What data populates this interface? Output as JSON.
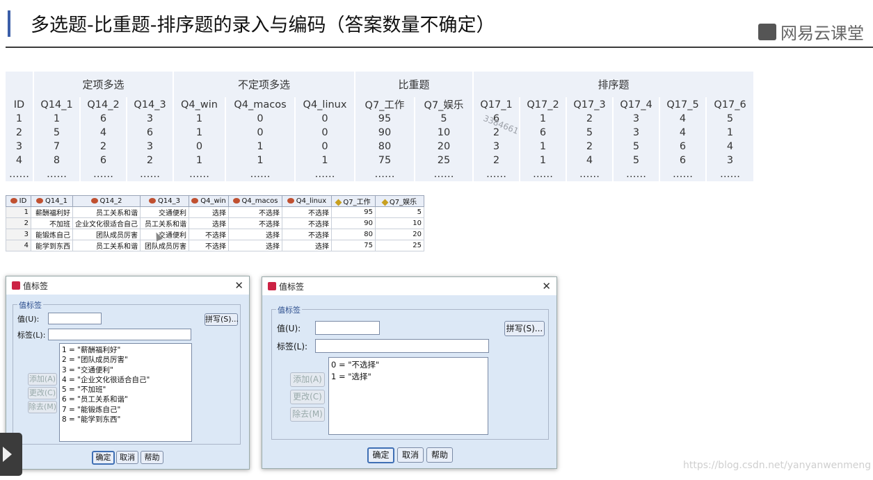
{
  "header": {
    "title": "多选题-比重题-排序题的录入与编码（答案数量不确定）",
    "logo": "网易云课堂"
  },
  "table": {
    "groups": [
      "定项多选",
      "不定项多选",
      "比重题",
      "排序题"
    ],
    "columns": [
      "ID",
      "Q14_1",
      "Q14_2",
      "Q14_3",
      "Q4_win",
      "Q4_macos",
      "Q4_linux",
      "Q7_工作",
      "Q7_娱乐",
      "Q17_1",
      "Q17_2",
      "Q17_3",
      "Q17_4",
      "Q17_5",
      "Q17_6"
    ],
    "rows": [
      [
        "1",
        "1",
        "6",
        "3",
        "1",
        "0",
        "0",
        "95",
        "5",
        "6",
        "1",
        "2",
        "3",
        "4",
        "5"
      ],
      [
        "2",
        "5",
        "4",
        "6",
        "1",
        "0",
        "0",
        "90",
        "10",
        "2",
        "6",
        "5",
        "3",
        "4",
        "1"
      ],
      [
        "3",
        "7",
        "2",
        "3",
        "0",
        "1",
        "0",
        "80",
        "20",
        "3",
        "1",
        "2",
        "5",
        "6",
        "4"
      ],
      [
        "4",
        "8",
        "6",
        "2",
        "1",
        "1",
        "1",
        "75",
        "25",
        "2",
        "1",
        "4",
        "5",
        "6",
        "3"
      ],
      [
        "……",
        "……",
        "……",
        "……",
        "……",
        "……",
        "……",
        "……",
        "……",
        "……",
        "……",
        "……",
        "……",
        "……",
        "……"
      ]
    ],
    "stamp": "3384661"
  },
  "spss": {
    "columns": [
      "ID",
      "Q14_1",
      "Q14_2",
      "Q14_3",
      "Q4_win",
      "Q4_macos",
      "Q4_linux",
      "Q7_工作",
      "Q7_娱乐"
    ],
    "rows": [
      [
        "1",
        "薪酬福利好",
        "员工关系和谐",
        "交通便利",
        "选择",
        "不选择",
        "不选择",
        "95",
        "5"
      ],
      [
        "2",
        "不加班",
        "企业文化很适合自己",
        "员工关系和谐",
        "选择",
        "不选择",
        "不选择",
        "90",
        "10"
      ],
      [
        "3",
        "能锻炼自己",
        "团队成员厉害",
        "交通便利",
        "不选择",
        "选择",
        "不选择",
        "80",
        "20"
      ],
      [
        "4",
        "能学到东西",
        "员工关系和谐",
        "团队成员厉害",
        "不选择",
        "选择",
        "选择",
        "75",
        "25"
      ]
    ]
  },
  "dialog_left": {
    "title": "值标签",
    "group": "值标签",
    "value_label": "值(U):",
    "label_label": "标签(L):",
    "spell": "拼写(S)...",
    "add": "添加(A)",
    "change": "更改(C)",
    "remove": "除去(M)",
    "items": [
      "1 = \"薪酬福利好\"",
      "2 = \"团队成员厉害\"",
      "3 = \"交通便利\"",
      "4 = \"企业文化很适合自己\"",
      "5 = \"不加班\"",
      "6 = \"员工关系和谐\"",
      "7 = \"能锻炼自己\"",
      "8 = \"能学到东西\""
    ],
    "ok": "确定",
    "cancel": "取消",
    "help": "帮助"
  },
  "dialog_right": {
    "title": "值标签",
    "group": "值标签",
    "value_label": "值(U):",
    "label_label": "标签(L):",
    "spell": "拼写(S)...",
    "add": "添加(A)",
    "change": "更改(C)",
    "remove": "除去(M)",
    "items": [
      "0 = \"不选择\"",
      "1 = \"选择\""
    ],
    "ok": "确定",
    "cancel": "取消",
    "help": "帮助"
  },
  "watermark": "https://blog.csdn.net/yanyanwenmeng"
}
